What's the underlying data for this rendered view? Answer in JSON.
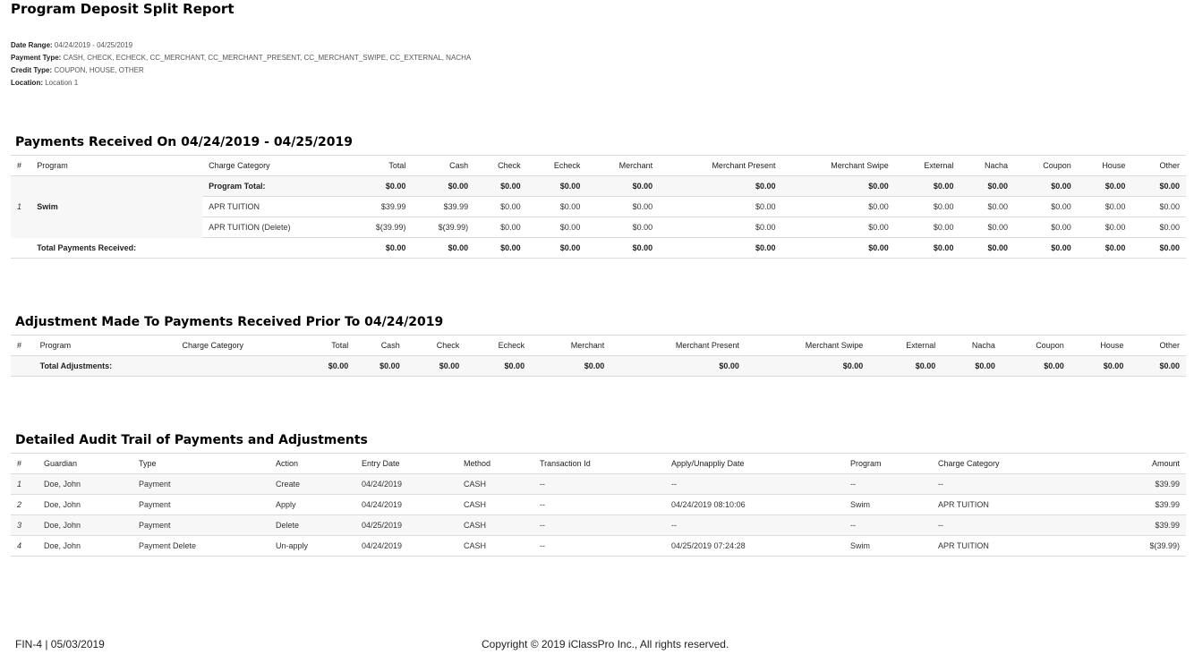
{
  "report": {
    "title": "Program Deposit Split Report",
    "filters": [
      {
        "key": "Date Range:",
        "value": "04/24/2019 - 04/25/2019"
      },
      {
        "key": "Payment Type:",
        "value": "CASH, CHECK, ECHECK, CC_MERCHANT, CC_MERCHANT_PRESENT, CC_MERCHANT_SWIPE, CC_EXTERNAL, NACHA"
      },
      {
        "key": "Credit Type:",
        "value": "COUPON, HOUSE, OTHER"
      },
      {
        "key": "Location:",
        "value": "Location 1"
      }
    ]
  },
  "payments": {
    "title": "Payments Received On 04/24/2019 - 04/25/2019",
    "headers": [
      "#",
      "Program",
      "Charge Category",
      "Total",
      "Cash",
      "Check",
      "Echeck",
      "Merchant",
      "Merchant Present",
      "Merchant Swipe",
      "External",
      "Nacha",
      "Coupon",
      "House",
      "Other"
    ],
    "row_num": "1",
    "program": "Swim",
    "rows": [
      {
        "category": "Program Total:",
        "values": [
          "$0.00",
          "$0.00",
          "$0.00",
          "$0.00",
          "$0.00",
          "$0.00",
          "$0.00",
          "$0.00",
          "$0.00",
          "$0.00",
          "$0.00",
          "$0.00"
        ]
      },
      {
        "category": "APR TUITION",
        "values": [
          "$39.99",
          "$39.99",
          "$0.00",
          "$0.00",
          "$0.00",
          "$0.00",
          "$0.00",
          "$0.00",
          "$0.00",
          "$0.00",
          "$0.00",
          "$0.00"
        ]
      },
      {
        "category": "APR TUITION (Delete)",
        "values": [
          "$(39.99)",
          "$(39.99)",
          "$0.00",
          "$0.00",
          "$0.00",
          "$0.00",
          "$0.00",
          "$0.00",
          "$0.00",
          "$0.00",
          "$0.00",
          "$0.00"
        ]
      }
    ],
    "total_label": "Total Payments Received:",
    "total_values": [
      "$0.00",
      "$0.00",
      "$0.00",
      "$0.00",
      "$0.00",
      "$0.00",
      "$0.00",
      "$0.00",
      "$0.00",
      "$0.00",
      "$0.00",
      "$0.00"
    ]
  },
  "adjustments": {
    "title": "Adjustment Made To Payments Received Prior To 04/24/2019",
    "headers": [
      "#",
      "Program",
      "Charge Category",
      "Total",
      "Cash",
      "Check",
      "Echeck",
      "Merchant",
      "Merchant Present",
      "Merchant Swipe",
      "External",
      "Nacha",
      "Coupon",
      "House",
      "Other"
    ],
    "total_label": "Total Adjustments:",
    "total_values": [
      "$0.00",
      "$0.00",
      "$0.00",
      "$0.00",
      "$0.00",
      "$0.00",
      "$0.00",
      "$0.00",
      "$0.00",
      "$0.00",
      "$0.00",
      "$0.00"
    ]
  },
  "audit": {
    "title": "Detailed Audit Trail of Payments and Adjustments",
    "headers": [
      "#",
      "Guardian",
      "Type",
      "Action",
      "Entry Date",
      "Method",
      "Transaction Id",
      "Apply/Unappliy Date",
      "Program",
      "Charge Category",
      "Amount"
    ],
    "rows": [
      [
        "1",
        "Doe, John",
        "Payment",
        "Create",
        "04/24/2019",
        "CASH",
        "--",
        "--",
        "--",
        "--",
        "$39.99"
      ],
      [
        "2",
        "Doe, John",
        "Payment",
        "Apply",
        "04/24/2019",
        "CASH",
        "--",
        "04/24/2019 08:10:06",
        "Swim",
        "APR TUITION",
        "$39.99"
      ],
      [
        "3",
        "Doe, John",
        "Payment",
        "Delete",
        "04/25/2019",
        "CASH",
        "--",
        "--",
        "--",
        "--",
        "$39.99"
      ],
      [
        "4",
        "Doe, John",
        "Payment Delete",
        "Un-apply",
        "04/24/2019",
        "CASH",
        "--",
        "04/25/2019 07:24:28",
        "Swim",
        "APR TUITION",
        "$(39.99)"
      ]
    ]
  },
  "footer": {
    "code": "FIN-4 | 05/03/2019",
    "copyright": "Copyright © 2019 iClassPro Inc., All rights reserved."
  }
}
